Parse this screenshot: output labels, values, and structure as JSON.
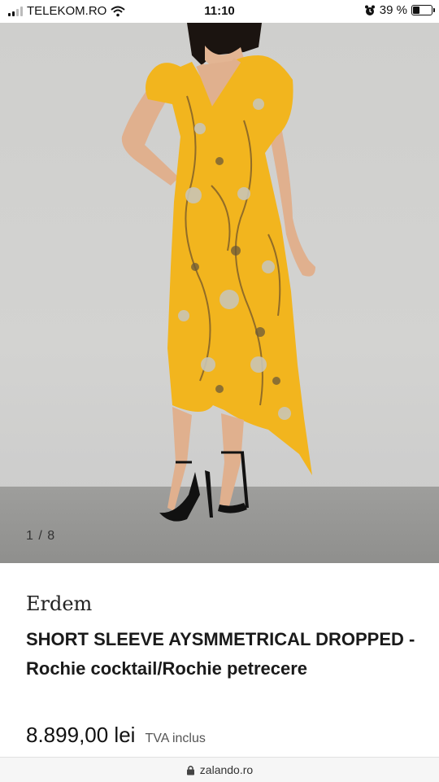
{
  "status_bar": {
    "carrier": "TELEKOM.RO",
    "time": "11:10",
    "battery_percent": "39 %",
    "battery_level": 0.39,
    "icons": [
      "signal-icon",
      "wifi-icon",
      "alarm-icon",
      "battery-icon"
    ]
  },
  "gallery": {
    "counter": "1 / 8",
    "dress_color": "#f2b51e",
    "wall_color": "#d2d2d0"
  },
  "product": {
    "brand": "Erdem",
    "title": "SHORT SLEEVE AYSMMETRICAL DROPPED - Rochie cocktail/Rochie petrecere",
    "price": "8.899,00 lei",
    "vat_note": "TVA inclus"
  },
  "browser": {
    "url": "zalando.ro",
    "icon": "lock-icon"
  }
}
